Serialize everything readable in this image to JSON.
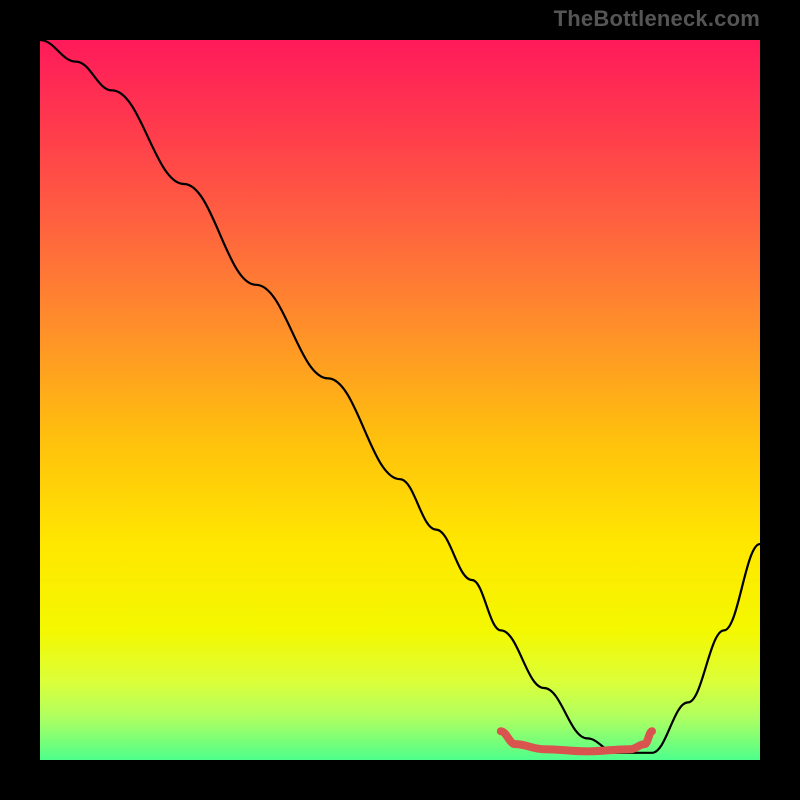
{
  "watermark": "TheBottleneck.com",
  "chart_data": {
    "type": "line",
    "title": "",
    "xlabel": "",
    "ylabel": "",
    "xlim": [
      0,
      100
    ],
    "ylim": [
      0,
      100
    ],
    "series": [
      {
        "name": "bottleneck-curve",
        "x": [
          0,
          5,
          10,
          20,
          30,
          40,
          50,
          55,
          60,
          64,
          70,
          76,
          80,
          85,
          90,
          95,
          100
        ],
        "values": [
          100,
          97,
          93,
          80,
          66,
          53,
          39,
          32,
          25,
          18,
          10,
          3,
          1,
          1,
          8,
          18,
          30
        ]
      },
      {
        "name": "recommended-range-marker",
        "x": [
          64,
          66,
          70,
          76,
          82,
          84,
          85
        ],
        "values": [
          4.0,
          2.2,
          1.5,
          1.2,
          1.5,
          2.2,
          4.0
        ]
      }
    ],
    "background_gradient": {
      "type": "vertical",
      "stops": [
        {
          "pos": 0.0,
          "color": "#ff1a5a"
        },
        {
          "pos": 0.12,
          "color": "#ff3a4d"
        },
        {
          "pos": 0.25,
          "color": "#ff6040"
        },
        {
          "pos": 0.4,
          "color": "#ff8f2a"
        },
        {
          "pos": 0.55,
          "color": "#ffbf0e"
        },
        {
          "pos": 0.7,
          "color": "#ffe700"
        },
        {
          "pos": 0.82,
          "color": "#f4f800"
        },
        {
          "pos": 0.89,
          "color": "#dcff38"
        },
        {
          "pos": 0.94,
          "color": "#b0ff60"
        },
        {
          "pos": 1.0,
          "color": "#4eff8c"
        }
      ]
    },
    "styles": {
      "bottleneck-curve": {
        "stroke": "#000000",
        "width": 2.2
      },
      "recommended-range-marker": {
        "stroke": "#d9534f",
        "width": 8
      }
    }
  }
}
